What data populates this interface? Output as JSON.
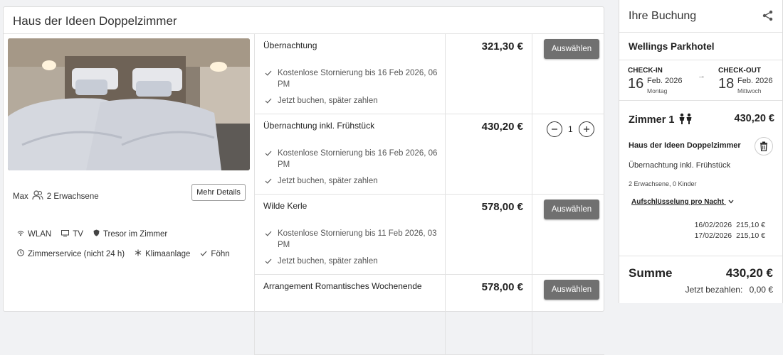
{
  "room": {
    "title": "Haus der Ideen Doppelzimmer",
    "occupancy_max": "Max",
    "occupancy_guests": "2 Erwachsene",
    "more_details": "Mehr Details",
    "amenities_row1": [
      {
        "icon": "wifi-icon",
        "label": "WLAN"
      },
      {
        "icon": "tv-icon",
        "label": "TV"
      },
      {
        "icon": "shield-icon",
        "label": "Tresor im Zimmer"
      }
    ],
    "amenities_row2": [
      {
        "icon": "clock-icon",
        "label": "Zimmerservice (nicht 24 h)"
      },
      {
        "icon": "snowflake-icon",
        "label": "Klimaanlage"
      },
      {
        "icon": "check-icon",
        "label": "Föhn"
      }
    ]
  },
  "rates": [
    {
      "name": "Übernachtung",
      "price": "321,30 €",
      "conditions": [
        "Kostenlose Stornierung bis 16 Feb 2026, 06 PM",
        "Jetzt buchen, später zahlen"
      ],
      "action": "Auswählen"
    },
    {
      "name": "Übernachtung inkl. Frühstück",
      "price": "430,20 €",
      "conditions": [
        "Kostenlose Stornierung bis 16 Feb 2026, 06 PM",
        "Jetzt buchen, später zahlen"
      ],
      "quantity": "1"
    },
    {
      "name": "Wilde Kerle",
      "price": "578,00 €",
      "conditions": [
        "Kostenlose Stornierung bis 11 Feb 2026, 03 PM",
        "Jetzt buchen, später zahlen"
      ],
      "action": "Auswählen"
    },
    {
      "name": "Arrangement Romantisches Wochenende",
      "price": "578,00 €",
      "conditions": [],
      "action": "Auswählen"
    }
  ],
  "booking": {
    "title": "Ihre Buchung",
    "hotel": "Wellings Parkhotel",
    "checkin_label": "CHECK-IN",
    "checkin_day": "16",
    "checkin_month": "Feb. 2026",
    "checkin_weekday": "Montag",
    "checkout_label": "CHECK-OUT",
    "checkout_day": "18",
    "checkout_month": "Feb. 2026",
    "checkout_weekday": "Mittwoch",
    "room_label": "Zimmer 1",
    "room_price": "430,20 €",
    "room_name": "Haus der Ideen Doppelzimmer",
    "rate_name": "Übernachtung inkl. Frühstück",
    "guests": "2 Erwachsene, 0 Kinder",
    "breakdown": "Aufschlüsselung pro Nacht",
    "nights": [
      {
        "date": "16/02/2026",
        "price": "215,10 €"
      },
      {
        "date": "17/02/2026",
        "price": "215,10 €"
      }
    ],
    "sum_label": "Summe",
    "sum_value": "430,20 €",
    "pay_now_label": "Jetzt bezahlen:",
    "pay_now_value": "0,00 €"
  },
  "colors": {
    "select_button": "#707070",
    "border": "#e2e2e2"
  }
}
